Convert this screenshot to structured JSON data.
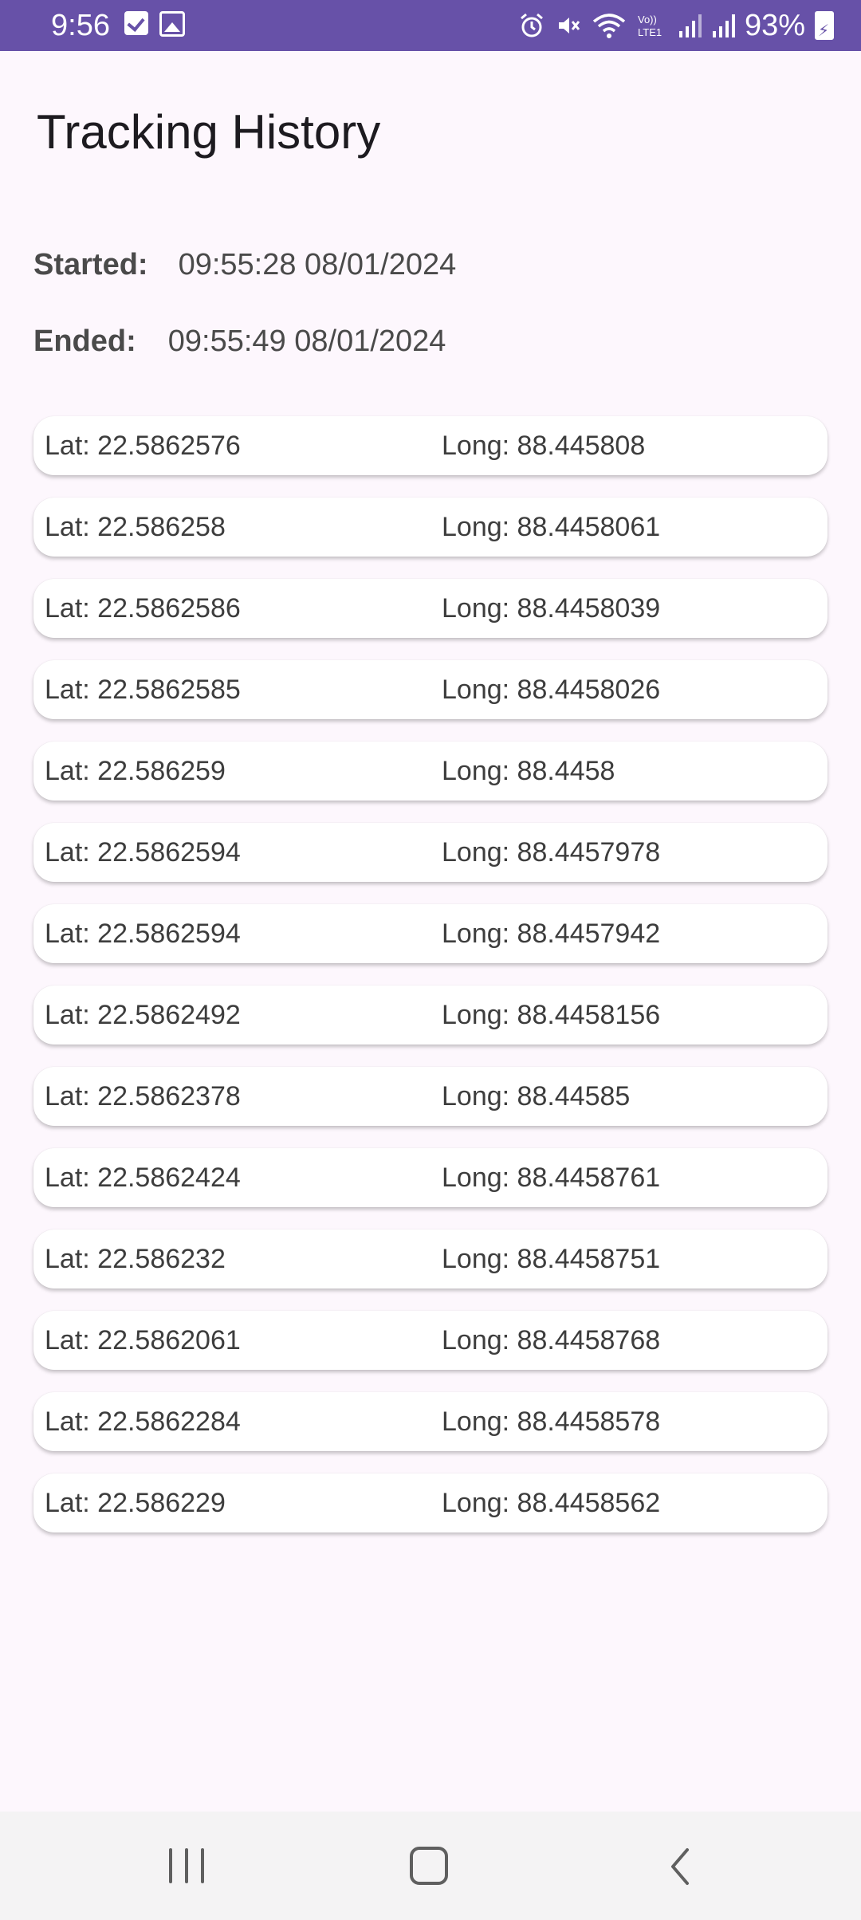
{
  "status_bar": {
    "time": "9:56",
    "battery": "93%",
    "icons": [
      "checkbox-icon",
      "image-icon",
      "alarm-icon",
      "mute-icon",
      "wifi-icon",
      "volte-icon",
      "signal-icon",
      "signal-icon",
      "battery-charging-icon"
    ],
    "network_label": "Vo)) LTE1"
  },
  "page": {
    "title": "Tracking History",
    "started_label": "Started:",
    "started_value": "09:55:28 08/01/2024",
    "ended_label": "Ended:",
    "ended_value": "09:55:49 08/01/2024"
  },
  "locations": [
    {
      "lat": "Lat: 22.5862576",
      "long": "Long: 88.445808"
    },
    {
      "lat": "Lat: 22.586258",
      "long": "Long: 88.4458061"
    },
    {
      "lat": "Lat: 22.5862586",
      "long": "Long: 88.4458039"
    },
    {
      "lat": "Lat: 22.5862585",
      "long": "Long: 88.4458026"
    },
    {
      "lat": "Lat: 22.586259",
      "long": "Long: 88.4458"
    },
    {
      "lat": "Lat: 22.5862594",
      "long": "Long: 88.4457978"
    },
    {
      "lat": "Lat: 22.5862594",
      "long": "Long: 88.4457942"
    },
    {
      "lat": "Lat: 22.5862492",
      "long": "Long: 88.4458156"
    },
    {
      "lat": "Lat: 22.5862378",
      "long": "Long: 88.44585"
    },
    {
      "lat": "Lat: 22.5862424",
      "long": "Long: 88.4458761"
    },
    {
      "lat": "Lat: 22.586232",
      "long": "Long: 88.4458751"
    },
    {
      "lat": "Lat: 22.5862061",
      "long": "Long: 88.4458768"
    },
    {
      "lat": "Lat: 22.5862284",
      "long": "Long: 88.4458578"
    },
    {
      "lat": "Lat: 22.586229",
      "long": "Long: 88.4458562"
    }
  ],
  "colors": {
    "status_bar": "#6751a8",
    "background": "#fdf7fd",
    "card": "#ffffff",
    "text": "#3d3d3d"
  },
  "nav_bar": {
    "icons": [
      "recents-icon",
      "home-icon",
      "back-icon"
    ]
  }
}
